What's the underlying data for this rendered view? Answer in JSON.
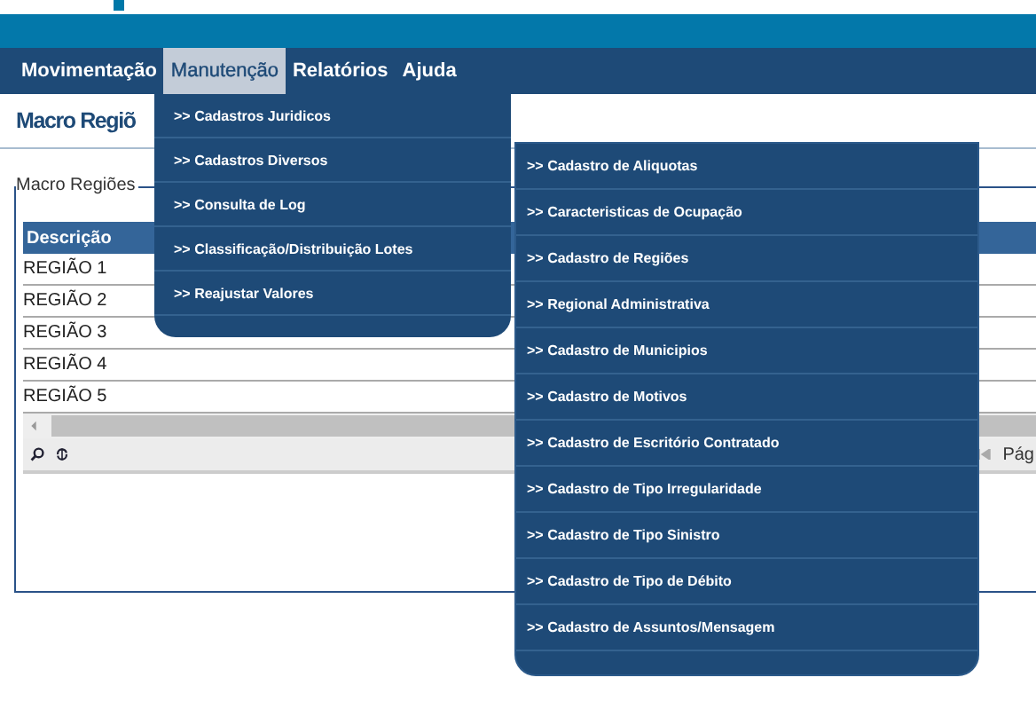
{
  "nav": [
    {
      "label": "Movimentação",
      "selected": false
    },
    {
      "label": "Manutenção",
      "selected": true
    },
    {
      "label": "Relatórios",
      "selected": false
    },
    {
      "label": "Ajuda",
      "selected": false
    }
  ],
  "page_title": "Macro Regiõ",
  "submenu": [
    {
      "label": ">> Cadastros Juridicos"
    },
    {
      "label": ">> Cadastros Diversos"
    },
    {
      "label": ">> Consulta de Log"
    },
    {
      "label": ">> Classificação/Distribuição Lotes"
    },
    {
      "label": ">> Reajustar Valores"
    }
  ],
  "flyout": [
    {
      "label": ">> Cadastro de Aliquotas"
    },
    {
      "label": ">> Caracteristicas de Ocupação"
    },
    {
      "label": ">> Cadastro de Regiões"
    },
    {
      "label": ">> Regional Administrativa"
    },
    {
      "label": ">> Cadastro de Municipios"
    },
    {
      "label": ">> Cadastro de Motivos"
    },
    {
      "label": ">> Cadastro de Escritório Contratado"
    },
    {
      "label": ">> Cadastro de Tipo Irregularidade"
    },
    {
      "label": ">> Cadastro de Tipo Sinistro"
    },
    {
      "label": ">> Cadastro de Tipo de Débito"
    },
    {
      "label": ">> Cadastro de Assuntos/Mensagem"
    }
  ],
  "fieldset": {
    "legend": "Macro Regiões",
    "table": {
      "columns": [
        "Descrição"
      ],
      "rows": [
        "REGIÃO 1",
        "REGIÃO 2",
        "REGIÃO 3",
        "REGIÃO 4",
        "REGIÃO 5"
      ]
    },
    "pager": {
      "page_label": "Pág"
    }
  }
}
